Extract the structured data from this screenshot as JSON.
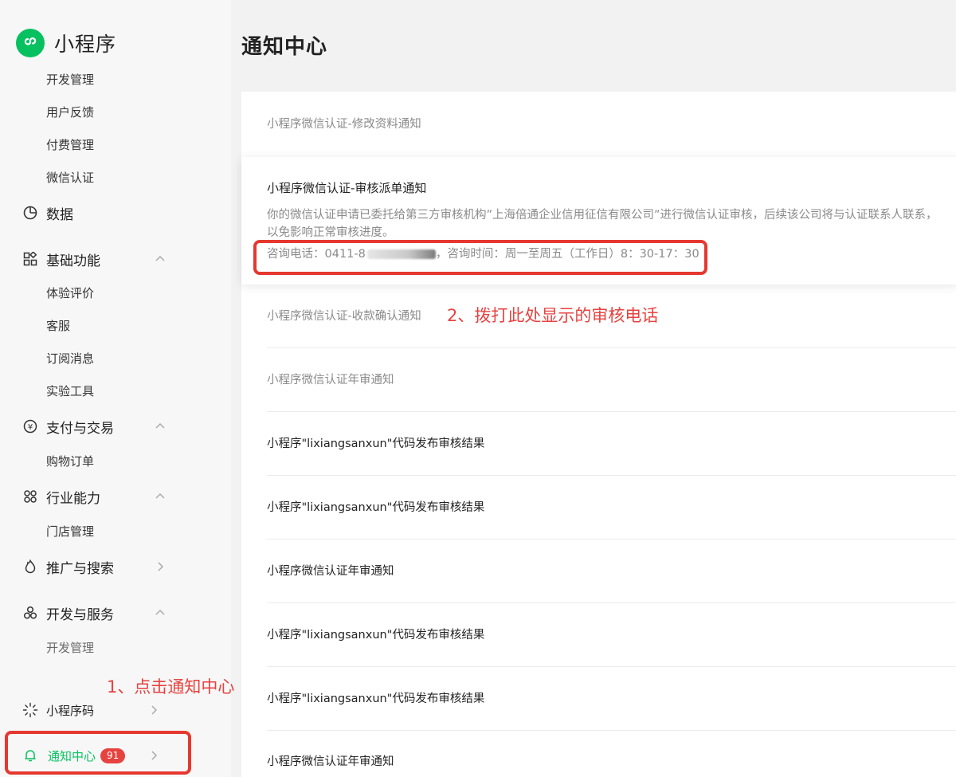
{
  "sidebar": {
    "brand_title": "小程序",
    "group0_items": [
      "开发管理",
      "用户反馈",
      "付费管理",
      "微信认证"
    ],
    "data_label": "数据",
    "basic": {
      "label": "基础功能",
      "items": [
        "体验评价",
        "客服",
        "订阅消息",
        "实验工具"
      ]
    },
    "payment": {
      "label": "支付与交易",
      "items": [
        "购物订单"
      ]
    },
    "industry": {
      "label": "行业能力",
      "items": [
        "门店管理"
      ]
    },
    "promo_label": "推广与搜索",
    "devservice": {
      "label": "开发与服务",
      "items": [
        "开发管理"
      ]
    },
    "qrcode_label": "小程序码",
    "notice_label": "通知中心",
    "notice_badge": "91"
  },
  "annotations": {
    "step1": "1、点击通知中心",
    "step2": "2、拨打此处显示的审核电话"
  },
  "main": {
    "title": "通知中心",
    "notices": [
      "小程序微信认证-修改资料通知",
      "小程序微信认证-收款确认通知",
      "小程序微信认证年审通知",
      "小程序\"lixiangsanxun\"代码发布审核结果",
      "小程序\"lixiangsanxun\"代码发布审核结果",
      "小程序微信认证年审通知",
      "小程序\"lixiangsanxun\"代码发布审核结果",
      "小程序\"lixiangsanxun\"代码发布审核结果",
      "小程序微信认证年审通知"
    ],
    "expanded": {
      "title": "小程序微信认证-审核派单通知",
      "body_line1": "你的微信认证申请已委托给第三方审核机构”上海倍通企业信用征信有限公司”进行微信认证审核，后续该公司将与认证联系人联系，",
      "body_line2": "以免影响正常审核进度。",
      "phone_prefix": "咨询电话：0411-8",
      "phone_suffix": "，咨询时间：周一至周五（工作日）8：30-17：30"
    }
  },
  "colors": {
    "accent_green": "#07c160",
    "annotation_red": "#e64340",
    "badge_red": "#e64340"
  },
  "icons": [
    "miniprogram-logo-icon",
    "pie-chart-icon",
    "grid-icon",
    "yen-icon",
    "industry-icon",
    "fire-icon",
    "services-icon",
    "qrcode-icon",
    "bell-icon",
    "chevron-up-icon",
    "chevron-right-icon"
  ]
}
